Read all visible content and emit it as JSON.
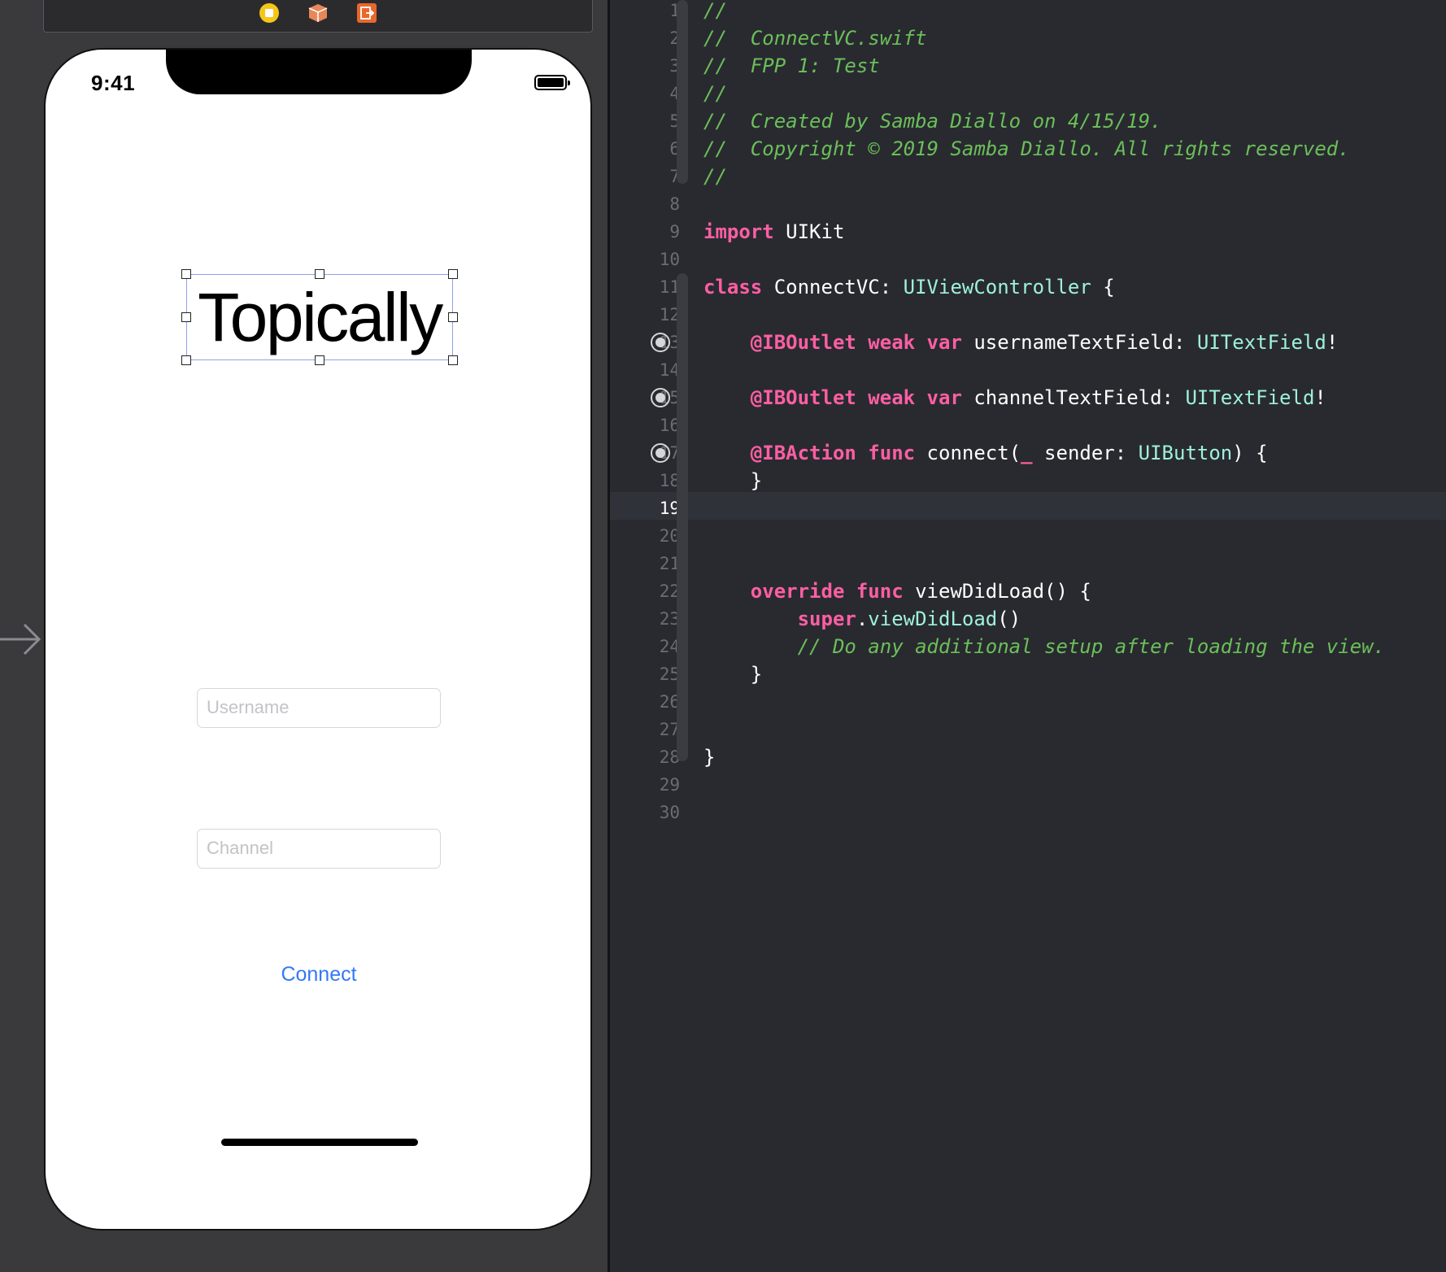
{
  "storyboard": {
    "dock_icons": [
      {
        "name": "view-controller-icon",
        "color": "#f5c518"
      },
      {
        "name": "first-responder-icon",
        "color": "#e8875a"
      },
      {
        "name": "exit-icon",
        "color": "#e8682c"
      }
    ],
    "status_bar": {
      "time": "9:41"
    },
    "title_label": "Topically",
    "username_field": {
      "placeholder": "Username"
    },
    "channel_field": {
      "placeholder": "Channel"
    },
    "connect_button": "Connect",
    "accent_color": "#3478f6"
  },
  "editor": {
    "active_line": 19,
    "outlet_lines": [
      13,
      15,
      17
    ],
    "lines": [
      {
        "n": "1",
        "tokens": [
          {
            "c": "cm",
            "t": "//"
          }
        ]
      },
      {
        "n": "2",
        "tokens": [
          {
            "c": "cm",
            "t": "//  ConnectVC.swift"
          }
        ]
      },
      {
        "n": "3",
        "tokens": [
          {
            "c": "cm",
            "t": "//  FPP 1: Test"
          }
        ]
      },
      {
        "n": "4",
        "tokens": [
          {
            "c": "cm",
            "t": "//"
          }
        ]
      },
      {
        "n": "5",
        "tokens": [
          {
            "c": "cm",
            "t": "//  Created by Samba Diallo on 4/15/19."
          }
        ]
      },
      {
        "n": "6",
        "tokens": [
          {
            "c": "cm",
            "t": "//  Copyright © 2019 Samba Diallo. All rights reserved."
          }
        ]
      },
      {
        "n": "7",
        "tokens": [
          {
            "c": "cm",
            "t": "//"
          }
        ]
      },
      {
        "n": "8",
        "tokens": []
      },
      {
        "n": "9",
        "tokens": [
          {
            "c": "kw",
            "t": "import"
          },
          {
            "c": "pl",
            "t": " UIKit"
          }
        ]
      },
      {
        "n": "10",
        "tokens": []
      },
      {
        "n": "11",
        "tokens": [
          {
            "c": "kw",
            "t": "class"
          },
          {
            "c": "pl",
            "t": " ConnectVC: "
          },
          {
            "c": "ty",
            "t": "UIViewController"
          },
          {
            "c": "pl",
            "t": " {"
          }
        ]
      },
      {
        "n": "12",
        "tokens": []
      },
      {
        "n": "13",
        "tokens": [
          {
            "c": "pl",
            "t": "    "
          },
          {
            "c": "kw",
            "t": "@IBOutlet"
          },
          {
            "c": "pl",
            "t": " "
          },
          {
            "c": "kw",
            "t": "weak"
          },
          {
            "c": "pl",
            "t": " "
          },
          {
            "c": "kw",
            "t": "var"
          },
          {
            "c": "pl",
            "t": " usernameTextField: "
          },
          {
            "c": "ty",
            "t": "UITextField"
          },
          {
            "c": "pl",
            "t": "!"
          }
        ]
      },
      {
        "n": "14",
        "tokens": []
      },
      {
        "n": "15",
        "tokens": [
          {
            "c": "pl",
            "t": "    "
          },
          {
            "c": "kw",
            "t": "@IBOutlet"
          },
          {
            "c": "pl",
            "t": " "
          },
          {
            "c": "kw",
            "t": "weak"
          },
          {
            "c": "pl",
            "t": " "
          },
          {
            "c": "kw",
            "t": "var"
          },
          {
            "c": "pl",
            "t": " channelTextField: "
          },
          {
            "c": "ty",
            "t": "UITextField"
          },
          {
            "c": "pl",
            "t": "!"
          }
        ]
      },
      {
        "n": "16",
        "tokens": []
      },
      {
        "n": "17",
        "tokens": [
          {
            "c": "pl",
            "t": "    "
          },
          {
            "c": "kw",
            "t": "@IBAction"
          },
          {
            "c": "pl",
            "t": " "
          },
          {
            "c": "kw",
            "t": "func"
          },
          {
            "c": "pl",
            "t": " connect("
          },
          {
            "c": "kw",
            "t": "_"
          },
          {
            "c": "pl",
            "t": " sender: "
          },
          {
            "c": "ty",
            "t": "UIButton"
          },
          {
            "c": "pl",
            "t": ") {"
          }
        ]
      },
      {
        "n": "18",
        "tokens": [
          {
            "c": "pl",
            "t": "    }"
          }
        ]
      },
      {
        "n": "19",
        "tokens": []
      },
      {
        "n": "20",
        "tokens": []
      },
      {
        "n": "21",
        "tokens": []
      },
      {
        "n": "22",
        "tokens": [
          {
            "c": "pl",
            "t": "    "
          },
          {
            "c": "kw",
            "t": "override"
          },
          {
            "c": "pl",
            "t": " "
          },
          {
            "c": "kw",
            "t": "func"
          },
          {
            "c": "pl",
            "t": " viewDidLoad() {"
          }
        ]
      },
      {
        "n": "23",
        "tokens": [
          {
            "c": "pl",
            "t": "        "
          },
          {
            "c": "kw",
            "t": "super"
          },
          {
            "c": "pl",
            "t": "."
          },
          {
            "c": "ty",
            "t": "viewDidLoad"
          },
          {
            "c": "pl",
            "t": "()"
          }
        ]
      },
      {
        "n": "24",
        "tokens": [
          {
            "c": "pl",
            "t": "        "
          },
          {
            "c": "cm",
            "t": "// Do any additional setup after loading the view."
          }
        ]
      },
      {
        "n": "25",
        "tokens": [
          {
            "c": "pl",
            "t": "    }"
          }
        ]
      },
      {
        "n": "26",
        "tokens": []
      },
      {
        "n": "27",
        "tokens": []
      },
      {
        "n": "28",
        "tokens": [
          {
            "c": "pl",
            "t": "}"
          }
        ]
      },
      {
        "n": "29",
        "tokens": []
      },
      {
        "n": "30",
        "tokens": []
      }
    ],
    "colors": {
      "background": "#292a30",
      "comment": "#6bbf59",
      "keyword": "#fc5fa3",
      "type": "#9ef1dd",
      "plain": "#ffffff",
      "line_number": "#6c6c74"
    }
  }
}
